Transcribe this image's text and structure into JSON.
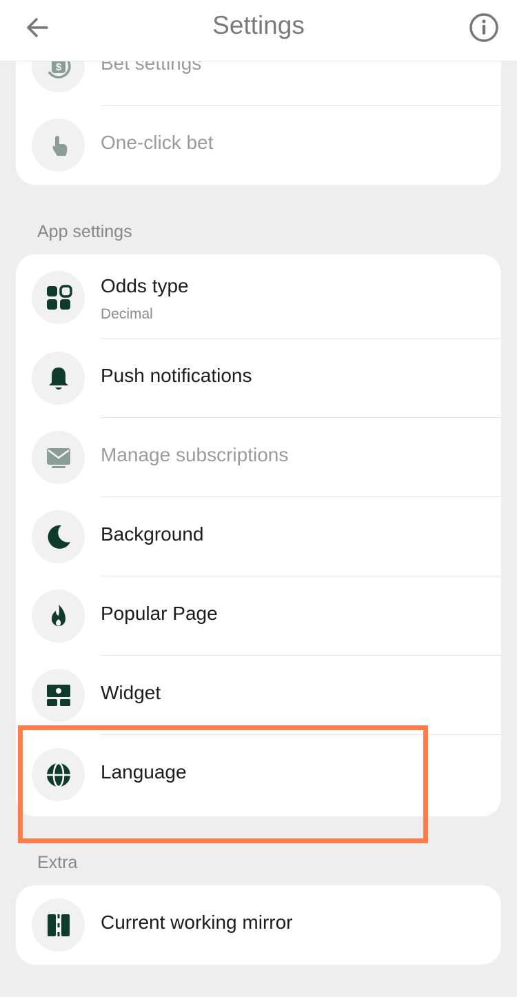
{
  "header": {
    "title": "Settings",
    "back_icon": "arrow-left-icon",
    "info_icon": "info-icon"
  },
  "bet_group": {
    "items": [
      {
        "label": "Bet settings",
        "icon": "dollar-refresh-icon",
        "state": "disabled"
      },
      {
        "label": "One-click bet",
        "icon": "tap-hand-icon",
        "state": "disabled"
      }
    ]
  },
  "app_settings": {
    "title": "App settings",
    "items": [
      {
        "label": "Odds type",
        "sub": "Decimal",
        "icon": "grid-icon"
      },
      {
        "label": "Push notifications",
        "icon": "bell-icon"
      },
      {
        "label": "Manage subscriptions",
        "icon": "mail-icon",
        "state": "disabled"
      },
      {
        "label": "Background",
        "icon": "moon-icon"
      },
      {
        "label": "Popular Page",
        "icon": "fire-icon"
      },
      {
        "label": "Widget",
        "icon": "widget-icon"
      },
      {
        "label": "Language",
        "icon": "globe-icon",
        "highlighted": true
      }
    ]
  },
  "extra": {
    "title": "Extra",
    "items": [
      {
        "label": "Current working mirror",
        "icon": "mirror-icon"
      }
    ]
  },
  "colors": {
    "icon": "#0e3b2c",
    "highlight": "#fd7d47",
    "background": "#eeeeee"
  }
}
